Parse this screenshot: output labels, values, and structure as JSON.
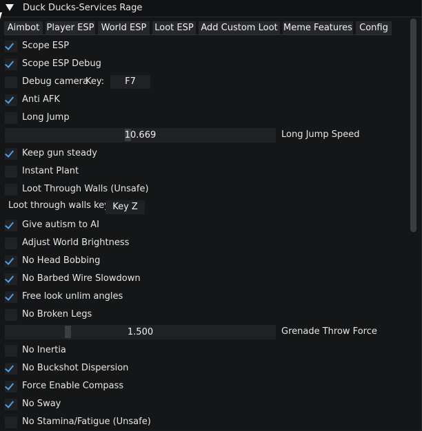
{
  "window": {
    "title": "Duck Ducks-Services Rage"
  },
  "tabs": [
    "Aimbot",
    "Player ESP",
    "World ESP",
    "Loot ESP",
    "Add Custom Loot",
    "Meme Features",
    "Config"
  ],
  "items": {
    "scope_esp": {
      "label": "Scope ESP",
      "checked": true
    },
    "scope_esp_debug": {
      "label": "Scope ESP Debug",
      "checked": true
    },
    "debug_camera": {
      "label": "Debug camera",
      "checked": false,
      "key_label": "Key:",
      "key_value": "F7"
    },
    "anti_afk": {
      "label": "Anti AFK",
      "checked": true
    },
    "long_jump": {
      "label": "Long Jump",
      "checked": false
    },
    "long_jump_speed": {
      "value": "10.669",
      "label": "Long Jump Speed"
    },
    "keep_gun_steady": {
      "label": "Keep gun steady",
      "checked": true
    },
    "instant_plant": {
      "label": "Instant Plant",
      "checked": false
    },
    "loot_through_walls": {
      "label": "Loot Through Walls (Unsafe)",
      "checked": false
    },
    "loot_walls_key": {
      "label": "Loot through walls key",
      "value": "Key Z"
    },
    "give_autism": {
      "label": "Give autism to AI",
      "checked": true
    },
    "adjust_world_brightness": {
      "label": "Adjust World Brightness",
      "checked": false
    },
    "no_head_bobbing": {
      "label": "No Head Bobbing",
      "checked": true
    },
    "no_barbed_wire": {
      "label": "No Barbed Wire Slowdown",
      "checked": true
    },
    "free_look": {
      "label": "Free look unlim angles",
      "checked": true
    },
    "no_broken_legs": {
      "label": "No Broken Legs",
      "checked": false
    },
    "grenade_force": {
      "value": "1.500",
      "label": "Grenade Throw Force"
    },
    "no_inertia": {
      "label": "No Inertia",
      "checked": false
    },
    "no_buckshot": {
      "label": "No Buckshot Dispersion",
      "checked": true
    },
    "force_compass": {
      "label": "Force Enable Compass",
      "checked": true
    },
    "no_sway": {
      "label": "No Sway",
      "checked": true
    },
    "no_stamina": {
      "label": "No Stamina/Fatigue (Unsafe)",
      "checked": false
    }
  },
  "colors": {
    "accent": "#4f9ee8",
    "background": "#151617",
    "frame": "#1f2124"
  }
}
